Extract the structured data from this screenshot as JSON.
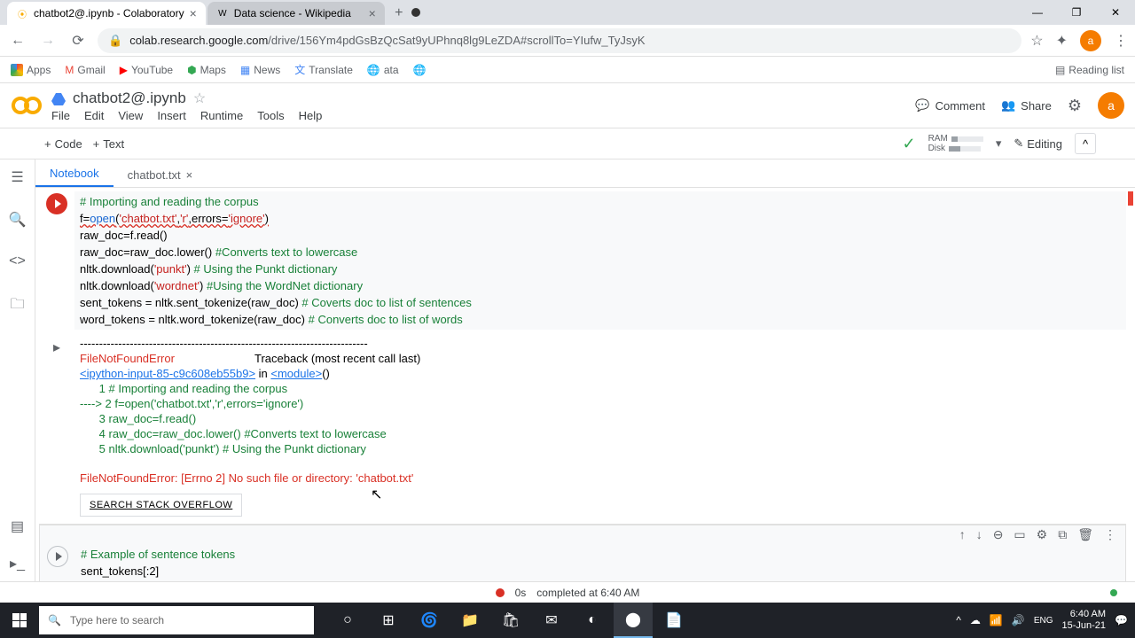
{
  "browser": {
    "tabs": [
      {
        "icon": "co",
        "title": "chatbot2@.ipynb - Colaboratory"
      },
      {
        "icon": "W",
        "title": "Data science - Wikipedia"
      }
    ],
    "url_host": "colab.research.google.com",
    "url_path": "/drive/156Ym4pdGsBzQcSat9yUPhnq8lg9LeZDA#scrollTo=YIufw_TyJsyK",
    "avatar": "a"
  },
  "bookmarks": {
    "items": [
      "Apps",
      "Gmail",
      "YouTube",
      "Maps",
      "News",
      "Translate",
      "ata"
    ],
    "reading": "Reading list"
  },
  "colab": {
    "title": "chatbot2@.ipynb",
    "menus": [
      "File",
      "Edit",
      "View",
      "Insert",
      "Runtime",
      "Tools",
      "Help"
    ],
    "comment": "Comment",
    "share": "Share",
    "avatar": "a"
  },
  "toolbar": {
    "code": "Code",
    "text": "Text",
    "ram": "RAM",
    "disk": "Disk",
    "editing": "Editing"
  },
  "filetabs": {
    "notebook": "Notebook",
    "chatbot": "chatbot.txt"
  },
  "code1": {
    "l1": "# Importing and reading the corpus",
    "l2a": "f=",
    "l2b": "open",
    "l2c": "(",
    "l2d": "'chatbot.txt'",
    "l2e": ",",
    "l2f": "'r'",
    "l2g": ",errors=",
    "l2h": "'ignore'",
    "l2i": ")",
    "l3": "raw_doc=f.read()",
    "l4a": "raw_doc=raw_doc.lower() ",
    "l4b": "#Converts text to lowercase",
    "l5a": "nltk.download(",
    "l5b": "'punkt'",
    "l5c": ") ",
    "l5d": "# Using the Punkt dictionary",
    "l6a": "nltk.download(",
    "l6b": "'wordnet'",
    "l6c": ") ",
    "l6d": "#Using the WordNet dictionary",
    "l7a": "sent_tokens = nltk.sent_tokenize(raw_doc) ",
    "l7b": "# Coverts doc to list of sentences",
    "l8a": "word_tokens = nltk.word_tokenize(raw_doc) ",
    "l8b": "# Converts doc to list of words"
  },
  "output": {
    "dash": "---------------------------------------------------------------------------",
    "err_name": "FileNotFoundError",
    "trace": "                         Traceback (most recent call last)",
    "link": "<ipython-input-85-c9c608eb55b9>",
    "inword": " in ",
    "module": "<module>",
    "paren": "()",
    "l1": "      1 # Importing and reading the corpus",
    "l2": "----> 2 f=open('chatbot.txt','r',errors='ignore')",
    "l3": "      3 raw_doc=f.read()",
    "l4": "      4 raw_doc=raw_doc.lower() #Converts text to lowercase",
    "l5": "      5 nltk.download('punkt') # Using the Punkt dictionary",
    "final": "FileNotFoundError: [Errno 2] No such file or directory: 'chatbot.txt'",
    "so_btn": "SEARCH STACK OVERFLOW"
  },
  "code2": {
    "l1": "# Example of sentence tokens",
    "l2": "sent_tokens[:2]"
  },
  "status": {
    "time": "0s",
    "msg": "completed at 6:40 AM"
  },
  "taskbar": {
    "search_ph": "Type here to search",
    "time": "6:40 AM",
    "date": "15-Jun-21"
  }
}
